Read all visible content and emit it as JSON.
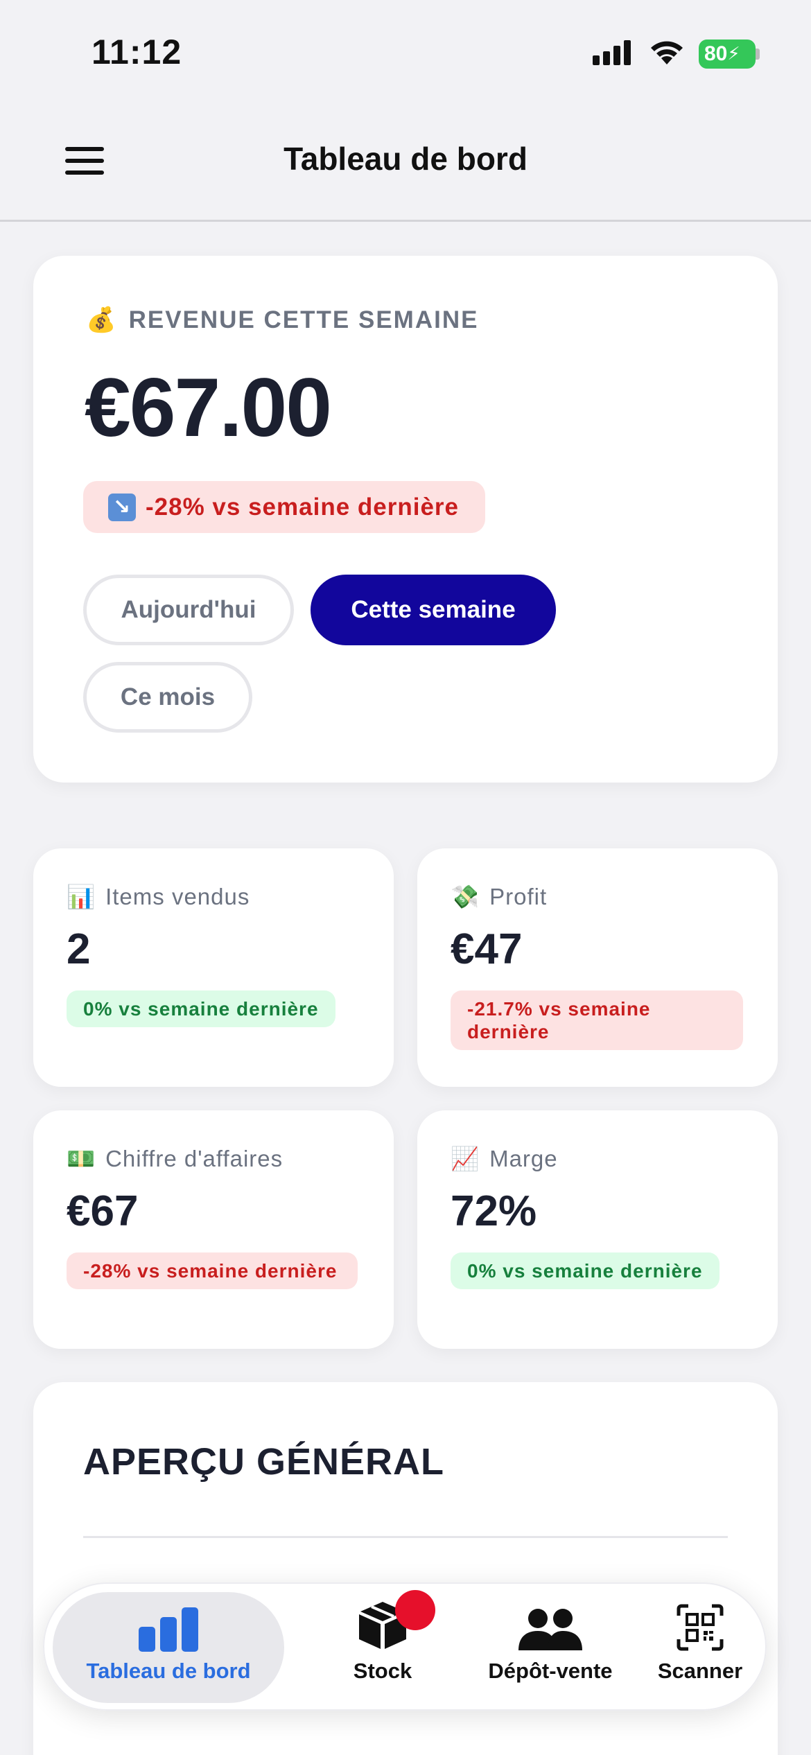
{
  "status_bar": {
    "time": "11:12",
    "battery": "80"
  },
  "header": {
    "title": "Tableau de bord"
  },
  "revenue": {
    "icon": "💰",
    "label": "REVENUE CETTE SEMAINE",
    "value": "€67.00",
    "trend_icon": "↘",
    "trend": "-28% vs semaine dernière",
    "periods": [
      "Aujourd'hui",
      "Cette semaine",
      "Ce mois"
    ],
    "selected_period": "Cette semaine"
  },
  "stats": [
    {
      "icon": "📊",
      "label": "Items vendus",
      "value": "2",
      "change": "0% vs semaine dernière",
      "trend": "neutral"
    },
    {
      "icon": "💸",
      "label": "Profit",
      "value": "€47",
      "change": "-21.7% vs semaine dernière",
      "trend": "negative"
    },
    {
      "icon": "💵",
      "label": "Chiffre d'affaires",
      "value": "€67",
      "change": "-28% vs semaine dernière",
      "trend": "negative"
    },
    {
      "icon": "📈",
      "label": "Marge",
      "value": "72%",
      "change": "0% vs semaine dernière",
      "trend": "neutral"
    }
  ],
  "overview": {
    "title": "APERÇU GÉNÉRAL"
  },
  "nav": {
    "items": [
      {
        "label": "Tableau de bord",
        "icon": "bar-chart-icon",
        "active": true
      },
      {
        "label": "Stock",
        "icon": "box-icon",
        "badge": true
      },
      {
        "label": "Dépôt-vente",
        "icon": "people-icon"
      },
      {
        "label": "Scanner",
        "icon": "qr-code-icon"
      }
    ]
  },
  "colors": {
    "primary": "#12069c",
    "accent_blue": "#2a6ddf",
    "negative": "#c81e1e",
    "negative_bg": "#fde2e2",
    "positive": "#17803d",
    "positive_bg": "#dcfce7",
    "badge_red": "#e6102b",
    "battery_green": "#34c759"
  }
}
